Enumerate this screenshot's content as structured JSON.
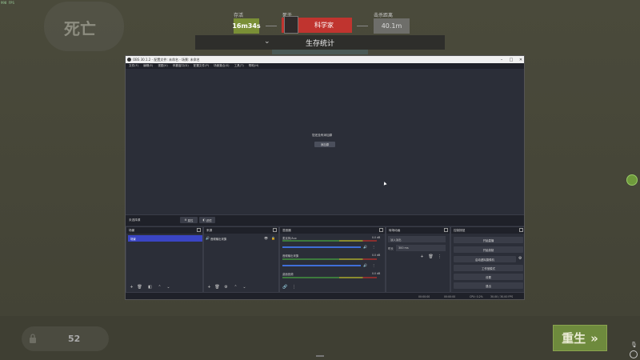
{
  "game": {
    "fps": "998 FPS",
    "death_title": "死亡",
    "survive_label": "存活",
    "survive_value": "16m34s",
    "killer_label": "死于",
    "killer_name": "科学家",
    "distance_label": "击杀距离",
    "distance_value": "40.1m",
    "stats_title": "生存统计",
    "lock_value": "52",
    "respawn_label": "重生",
    "respawn_icon": "double-chevron-right-icon",
    "accent_green": "#6e8a3d",
    "killer_red": "#c0342f"
  },
  "obs": {
    "title": "OBS 30.1.2 - 配置文件: 未命名 - 场景: 未命名",
    "menu": [
      "文件(F)",
      "编辑(E)",
      "视图(V)",
      "停靠窗口(D)",
      "配置文件(P)",
      "场景集合(S)",
      "工具(T)",
      "帮助(H)"
    ],
    "preview": {
      "no_source_text": "您还没有添加源",
      "add_source_label": "添加源"
    },
    "context_bar": {
      "label": "未选择源",
      "properties_label": "属性",
      "filters_label": "滤镜"
    },
    "docks": {
      "scenes": {
        "title": "场景",
        "items": [
          "场景"
        ]
      },
      "sources": {
        "title": "来源",
        "items": [
          "音频输出采集"
        ]
      },
      "mixer": {
        "title": "混音器",
        "channels": [
          {
            "name": "麦克风/Aux",
            "db": "0.0 dB"
          },
          {
            "name": "音频输出采集",
            "db": "0.0 dB"
          },
          {
            "name": "桌面音频",
            "db": "0.0 dB"
          }
        ],
        "scale": [
          "-60",
          "-55",
          "-50",
          "-45",
          "-40",
          "-35",
          "-30",
          "-25",
          "-20",
          "-15",
          "-10",
          "-5",
          "0"
        ]
      },
      "transitions": {
        "title": "转场动画",
        "selected": "淡入淡出",
        "duration_label": "时长",
        "duration_value": "300 ms"
      },
      "controls": {
        "title": "控制按钮",
        "buttons": [
          "开始直播",
          "开始录制",
          "启动虚拟摄像机",
          "工作室模式",
          "设置",
          "退出"
        ]
      }
    },
    "status": {
      "time_stream": "00:00:00",
      "time_record": "00:00:00",
      "cpu": "CPU: 0.2%",
      "fps": "30.00 / 30.00 FPS"
    }
  }
}
